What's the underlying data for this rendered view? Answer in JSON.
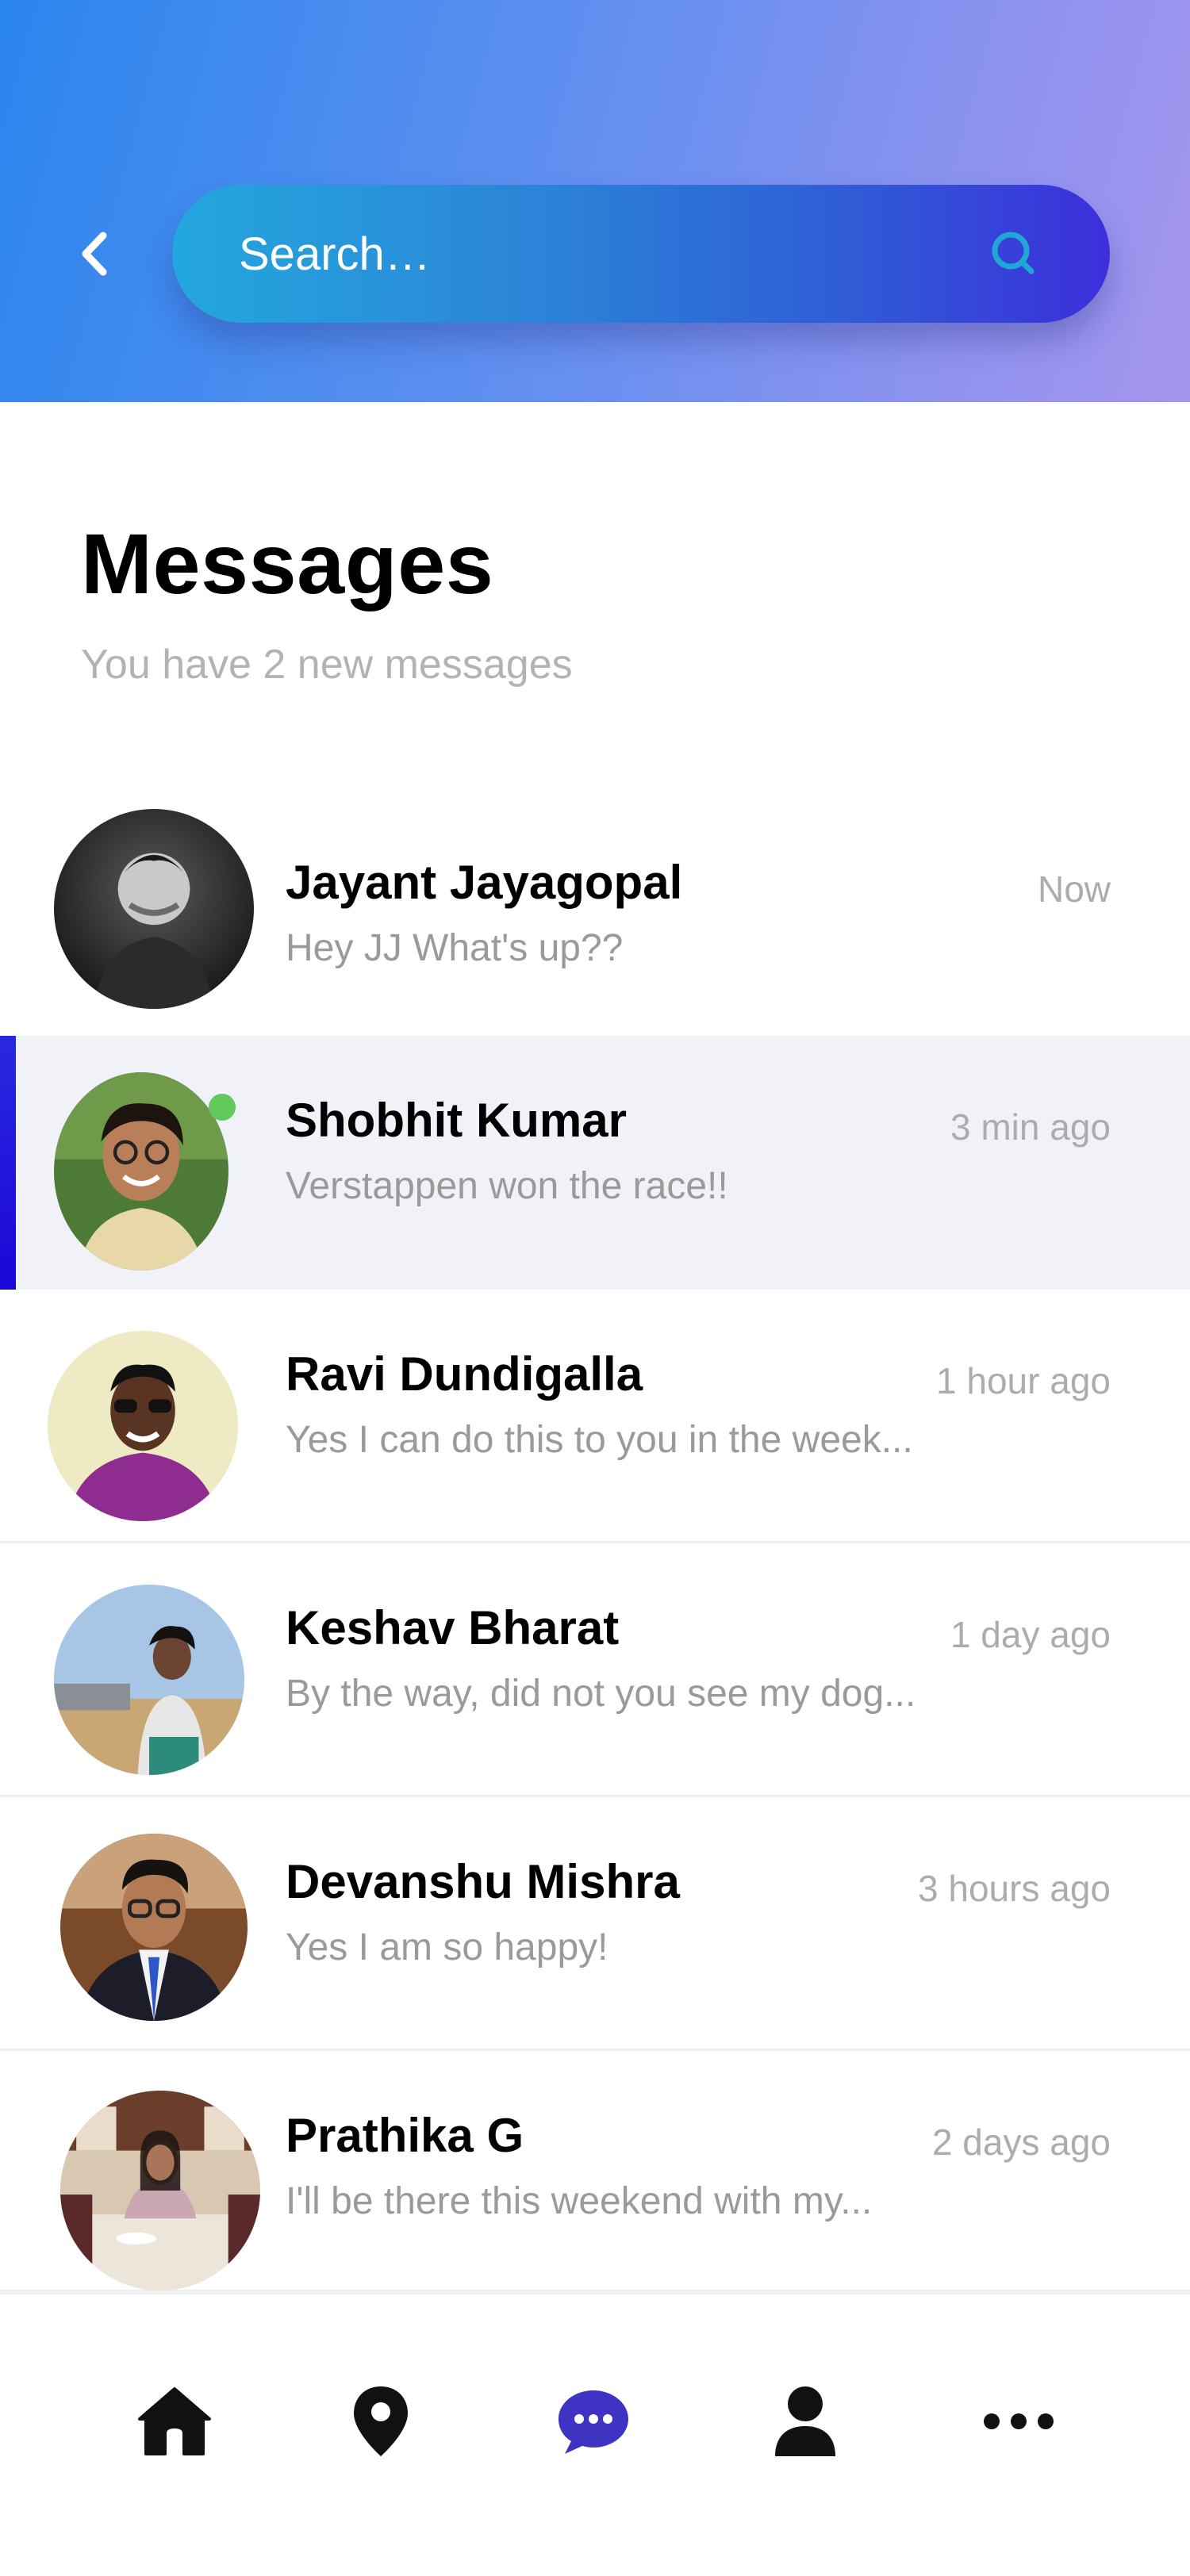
{
  "header": {
    "search_placeholder": "Search…",
    "gradient_colors": [
      "#2a86ee",
      "#a595ee"
    ],
    "search_gradient_colors": [
      "#23a7dd",
      "#3b2fdb"
    ]
  },
  "main": {
    "title": "Messages",
    "subtitle": "You have 2 new messages"
  },
  "messages": [
    {
      "name": "Jayant Jayagopal",
      "preview": "Hey JJ What's up??",
      "time": "Now",
      "avatar": "avatar-jayant",
      "active": false,
      "online": false
    },
    {
      "name": "Shobhit Kumar",
      "preview": "Verstappen won the race!!",
      "time": "3 min ago",
      "avatar": "avatar-shobhit",
      "active": true,
      "online": true
    },
    {
      "name": "Ravi Dundigalla",
      "preview": "Yes I can do this to you in the week...",
      "time": "1 hour ago",
      "avatar": "avatar-ravi",
      "active": false,
      "online": false
    },
    {
      "name": "Keshav Bharat",
      "preview": "By the way, did not you see my dog...",
      "time": "1 day ago",
      "avatar": "avatar-keshav",
      "active": false,
      "online": false
    },
    {
      "name": "Devanshu Mishra",
      "preview": "Yes I am so happy!",
      "time": "3 hours ago",
      "avatar": "avatar-devanshu",
      "active": false,
      "online": false
    },
    {
      "name": "Prathika G",
      "preview": "I'll be there this weekend with my...",
      "time": "2 days ago",
      "avatar": "avatar-prathika",
      "active": false,
      "online": false
    }
  ],
  "bottom_nav": [
    {
      "icon": "home-icon",
      "selected": false
    },
    {
      "icon": "location-pin-icon",
      "selected": false
    },
    {
      "icon": "chat-bubble-icon",
      "selected": true
    },
    {
      "icon": "user-icon",
      "selected": false
    },
    {
      "icon": "more-icon",
      "selected": false
    }
  ],
  "colors": {
    "active_row_bg": "#f1f2f8",
    "active_indicator": "#1a07d6",
    "online_dot": "#62c95d",
    "selected_nav": "#3f33c4",
    "muted_text": "#9a9a9a"
  }
}
